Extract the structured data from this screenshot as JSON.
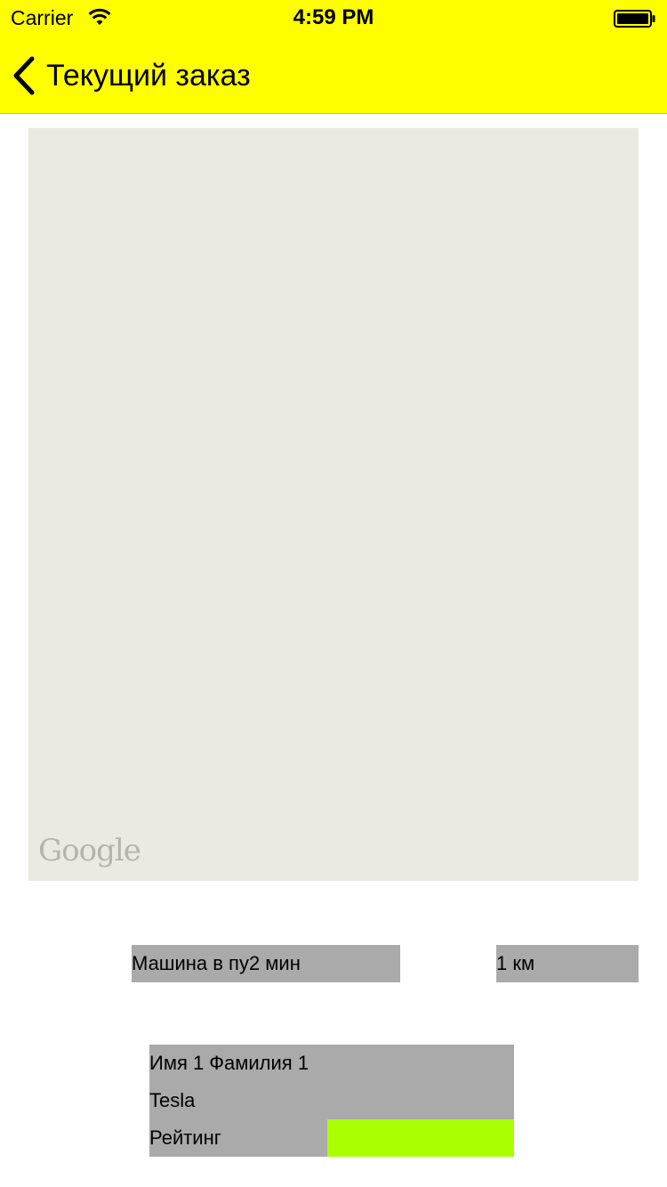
{
  "status_bar": {
    "carrier": "Carrier",
    "time": "4:59 PM"
  },
  "nav": {
    "title": "Текущий заказ"
  },
  "map": {
    "logo_text": "Google"
  },
  "ride": {
    "eta_text": "Машина в пу2 мин",
    "distance_text": "1 км"
  },
  "driver": {
    "name": "Имя 1 Фамилия 1",
    "car": "Tesla",
    "rating_label": "Рейтинг"
  },
  "colors": {
    "bar_background": "#ffff00",
    "label_background": "#aaaaaa",
    "rating_fill": "#aaff00",
    "map_background": "#ece9e2"
  }
}
